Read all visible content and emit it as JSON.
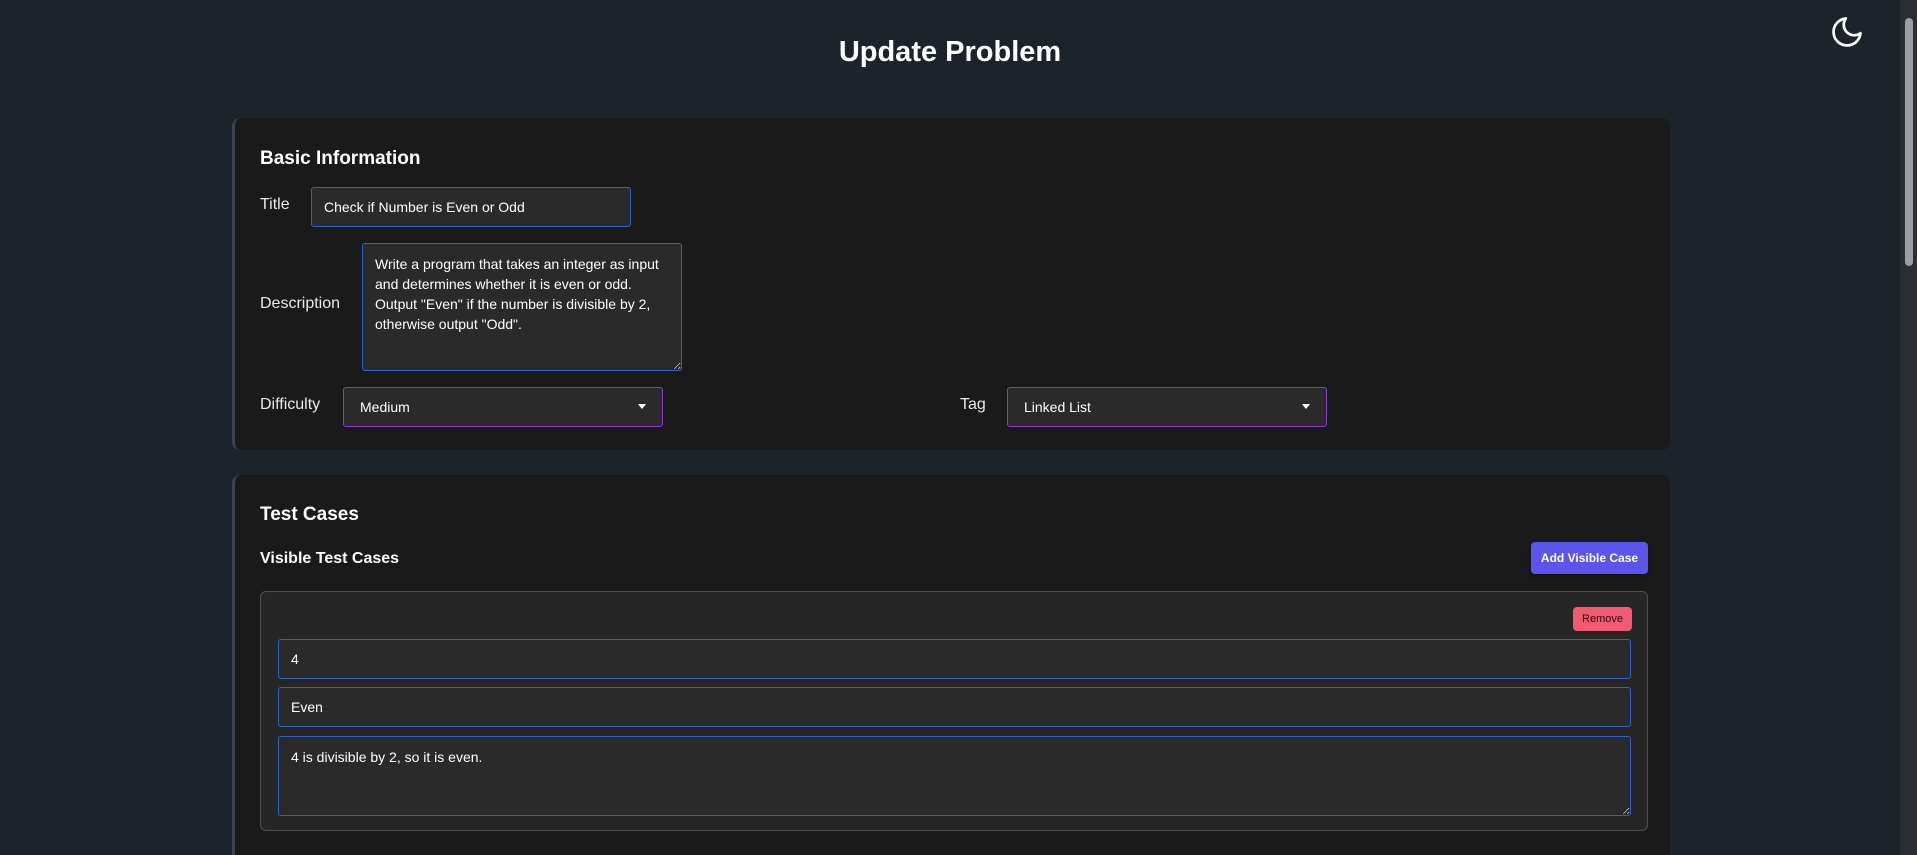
{
  "header": {
    "title": "Update Problem",
    "theme_icon": "moon-icon"
  },
  "basic_info": {
    "heading": "Basic Information",
    "title_label": "Title",
    "title_value": "Check if Number is Even or Odd",
    "description_label": "Description",
    "description_value": "Write a program that takes an integer as input and determines whether it is even or odd. Output \"Even\" if the number is divisible by 2, otherwise output \"Odd\".",
    "difficulty_label": "Difficulty",
    "difficulty_value": "Medium",
    "tag_label": "Tag",
    "tag_value": "Linked List"
  },
  "test_cases": {
    "heading": "Test Cases",
    "visible_heading": "Visible Test Cases",
    "add_button_label": "Add Visible Case",
    "cases": [
      {
        "remove_label": "Remove",
        "input": "4",
        "output": "Even",
        "explanation": "4 is divisible by 2, so it is even."
      }
    ]
  },
  "colors": {
    "background": "#1d232a",
    "card": "#1a1a1a",
    "input_border": "#3060c8",
    "select_border": "#8a3ad8",
    "primary_button": "#5b55ec",
    "remove_button": "#f25a72"
  }
}
